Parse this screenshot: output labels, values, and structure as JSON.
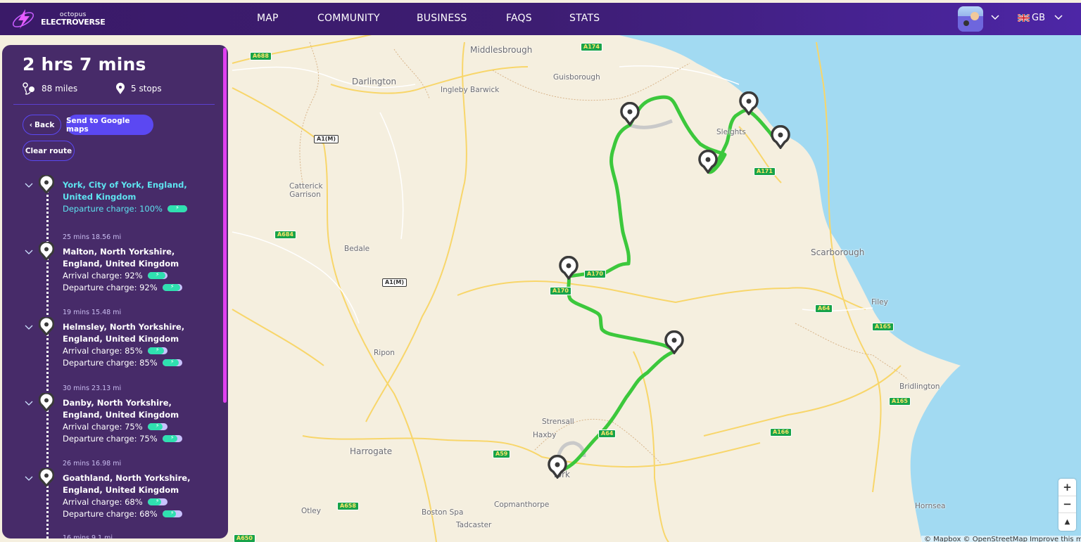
{
  "nav": {
    "brand_line1": "octopus",
    "brand_line2": "ELECTROVERSE",
    "items": [
      "MAP",
      "COMMUNITY",
      "BUSINESS",
      "FAQS",
      "STATS"
    ],
    "language": "GB"
  },
  "route": {
    "duration": "2 hrs 7 mins",
    "distance": "88 miles",
    "stops": "5 stops",
    "back_label": "Back",
    "google_label": "Send to Google maps",
    "clear_label": "Clear route",
    "stops_list": [
      {
        "leg": "",
        "name": "York, City of York, England, United Kingdom",
        "arrival": "",
        "departure": "Departure charge: 100%",
        "arrival_pct": null,
        "departure_pct": 100
      },
      {
        "leg": "25 mins 18.56 mi",
        "name": "Malton, North Yorkshire, England, United Kingdom",
        "arrival": "Arrival charge: 92%",
        "departure": "Departure charge: 92%",
        "arrival_pct": 92,
        "departure_pct": 92
      },
      {
        "leg": "19 mins 15.48 mi",
        "name": "Helmsley, North Yorkshire, England, United Kingdom",
        "arrival": "Arrival charge: 85%",
        "departure": "Departure charge: 85%",
        "arrival_pct": 85,
        "departure_pct": 85
      },
      {
        "leg": "30 mins 23.13 mi",
        "name": "Danby, North Yorkshire, England, United Kingdom",
        "arrival": "Arrival charge: 75%",
        "departure": "Departure charge: 75%",
        "arrival_pct": 75,
        "departure_pct": 75
      },
      {
        "leg": "26 mins 16.98 mi",
        "name": "Goathland, North Yorkshire, England, United Kingdom",
        "arrival": "Arrival charge: 68%",
        "departure": "Departure charge: 68%",
        "arrival_pct": 68,
        "departure_pct": 68
      }
    ],
    "next_leg_partial": "16 mins 9.1 mi"
  },
  "map": {
    "places": [
      "Middlesbrough",
      "Darlington",
      "Ingleby Barwick",
      "Guisborough",
      "Catterick Garrison",
      "Bedale",
      "Ripon",
      "Harrogate",
      "Otley",
      "Boston Spa",
      "Tadcaster",
      "Copmanthorpe",
      "York",
      "Haxby",
      "Strensall",
      "Sleights",
      "Scarborough",
      "Filey",
      "Bridlington",
      "Hornsea"
    ],
    "roads": [
      "A688",
      "A1(M)",
      "A174",
      "A171",
      "A684",
      "A1(M)",
      "A170",
      "A170",
      "A64",
      "A165",
      "A165",
      "A59",
      "A64",
      "A166",
      "A658",
      "A650"
    ],
    "attribution": "© Mapbox © OpenStreetMap Improve this map",
    "zoom_in": "+",
    "zoom_out": "−",
    "compass": "▲",
    "route_color": "#3cc83c",
    "water_color": "#a2daf2"
  }
}
